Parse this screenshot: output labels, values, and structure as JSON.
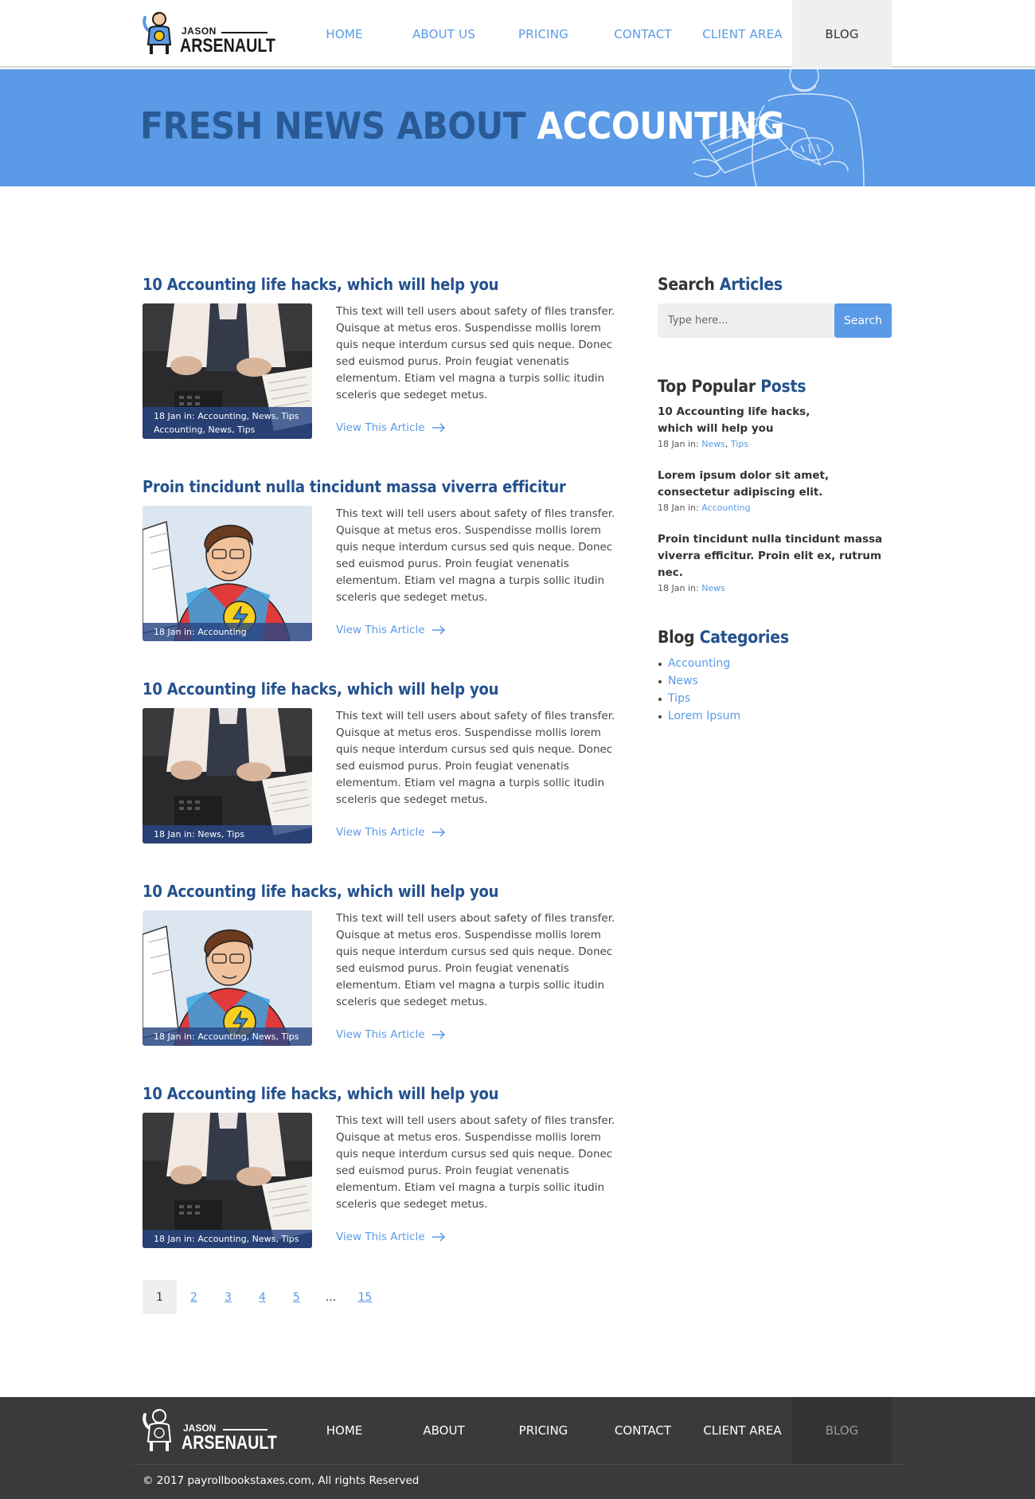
{
  "brand": {
    "line1": "JASON",
    "line2": "ARSENAULT"
  },
  "nav": [
    {
      "label": "HOME",
      "active": false
    },
    {
      "label": "ABOUT US",
      "active": false
    },
    {
      "label": "PRICING",
      "active": false
    },
    {
      "label": "CONTACT",
      "active": false
    },
    {
      "label": "CLIENT AREA",
      "active": false
    },
    {
      "label": "BLOG",
      "active": true
    }
  ],
  "hero": {
    "title_dark": "FRESH NEWS ABOUT ",
    "title_light": "ACCOUNTING"
  },
  "meta_prefix": "18 Jan in:",
  "posts": [
    {
      "title": "10 Accounting life hacks, which will help you",
      "image": "accountant-desk",
      "meta_line1": [
        "Accounting",
        "News",
        "Tips"
      ],
      "meta_line2": [
        "Accounting",
        "News",
        "Tips"
      ],
      "excerpt": "This text will tell users about safety of files transfer. Quisque at metus eros. Suspendisse mollis lorem quis neque interdum cursus sed quis neque. Donec sed euismod purus. Proin feugiat venenatis elementum. Etiam vel magna a turpis sollic itudin sceleris que sedeget metus.",
      "link": "View This Article"
    },
    {
      "title": "Proin tincidunt nulla tincidunt massa viverra efficitur",
      "image": "superhero-accountant",
      "meta_line1": [
        "Accounting"
      ],
      "meta_line2": [],
      "excerpt": "This text will tell users about safety of files transfer. Quisque at metus eros. Suspendisse mollis lorem quis neque interdum cursus sed quis neque. Donec sed euismod purus. Proin feugiat venenatis elementum. Etiam vel magna a turpis sollic itudin sceleris que sedeget metus.",
      "link": "View This Article"
    },
    {
      "title": "10 Accounting life hacks, which will help you",
      "image": "accountant-desk",
      "meta_line1": [
        "News",
        "Tips"
      ],
      "meta_line2": [],
      "excerpt": "This text will tell users about safety of files transfer. Quisque at metus eros. Suspendisse mollis lorem quis neque interdum cursus sed quis neque. Donec sed euismod purus. Proin feugiat venenatis elementum. Etiam vel magna a turpis sollic itudin sceleris que sedeget metus.",
      "link": "View This Article"
    },
    {
      "title": "10 Accounting life hacks, which will help you",
      "image": "superhero-accountant",
      "meta_line1": [
        "Accounting",
        "News",
        "Tips"
      ],
      "meta_line2": [],
      "excerpt": "This text will tell users about safety of files transfer. Quisque at metus eros. Suspendisse mollis lorem quis neque interdum cursus sed quis neque. Donec sed euismod purus. Proin feugiat venenatis elementum. Etiam vel magna a turpis sollic itudin sceleris que sedeget metus.",
      "link": "View This Article"
    },
    {
      "title": "10 Accounting life hacks, which will help you",
      "image": "accountant-desk",
      "meta_line1": [
        "Accounting",
        "News",
        "Tips"
      ],
      "meta_line2": [],
      "excerpt": "This text will tell users about safety of files transfer. Quisque at metus eros. Suspendisse mollis lorem quis neque interdum cursus sed quis neque. Donec sed euismod purus. Proin feugiat venenatis elementum. Etiam vel magna a turpis sollic itudin sceleris que sedeget metus.",
      "link": "View This Article"
    }
  ],
  "pagination": {
    "pages": [
      "1",
      "2",
      "3",
      "4",
      "5",
      "...",
      "15"
    ],
    "current": "1"
  },
  "sidebar": {
    "search": {
      "title_dark": "Search ",
      "title_blue": "Articles",
      "placeholder": "Type here...",
      "button": "Search"
    },
    "popular": {
      "title_dark": "Top Popular ",
      "title_blue": "Posts",
      "items": [
        {
          "title": "10 Accounting life hacks, which will help you",
          "tags": [
            "News",
            "Tips"
          ]
        },
        {
          "title": "Lorem ipsum dolor sit amet, consectetur adipiscing elit.",
          "tags": [
            "Accounting"
          ]
        },
        {
          "title": "Proin tincidunt nulla tincidunt massa viverra efficitur. Proin elit ex, rutrum nec.",
          "tags": [
            "News"
          ]
        }
      ]
    },
    "categories": {
      "title_dark": "Blog ",
      "title_blue": "Categories",
      "items": [
        "Accounting",
        "News",
        "Tips",
        "Lorem Ipsum"
      ]
    }
  },
  "footer": {
    "nav": [
      {
        "label": "HOME",
        "active": false
      },
      {
        "label": "ABOUT",
        "active": false
      },
      {
        "label": "PRICING",
        "active": false
      },
      {
        "label": "CONTACT",
        "active": false
      },
      {
        "label": "CLIENT AREA",
        "active": false
      },
      {
        "label": "BLOG",
        "active": true
      }
    ],
    "copyright": "© 2017 payrollbookstaxes.com, All rights Reserved"
  },
  "colors": {
    "accent": "#5a9ae6",
    "heading": "#24518e",
    "hero_dark": "#2a5a96",
    "footer_bg": "#3a3a3a"
  }
}
